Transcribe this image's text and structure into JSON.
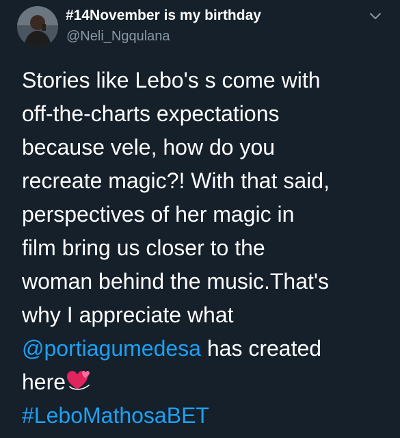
{
  "author": {
    "display_name": "#14November is my birthday",
    "handle": "@Neli_Ngqulana"
  },
  "tweet": {
    "lines": [
      "Stories like Lebo's s come with",
      "off-the-charts expectations",
      "because vele, how do you",
      "recreate magic?! With that said,",
      "perspectives of her magic in",
      "film bring us closer to the",
      "woman behind the music.That's",
      "why I appreciate what"
    ],
    "mention": "@portiagumedesa",
    "after_mention": " has created",
    "last_word": "here",
    "emoji": "revolving-hearts",
    "hashtag": "#LeboMathosaBET"
  },
  "colors": {
    "background": "#15202b",
    "text": "#ffffff",
    "secondary": "#8899a6",
    "link": "#1da1f2",
    "heart": "#e0245e"
  }
}
